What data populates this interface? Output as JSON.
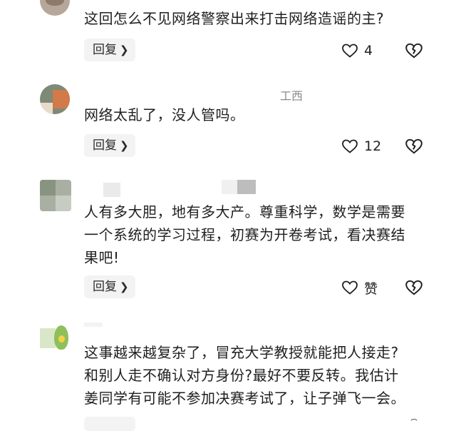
{
  "comments": [
    {
      "text": "这回怎么不见网络警察出来打击网络造谣的主?",
      "reply_label": "回复",
      "like_count": "4"
    },
    {
      "location": "工西",
      "text": "网络太乱了，没人管吗。",
      "reply_label": "回复",
      "like_count": "12"
    },
    {
      "text_lines": [
        "人有多大胆，地有多大产。尊重科学，数学是需要",
        "一个系统的学习过程，初赛为开卷考试，看决赛结",
        "果吧!"
      ],
      "reply_label": "回复",
      "like_count": "赞"
    },
    {
      "text_lines": [
        "这事越来越复杂了，冒充大学教授就能把人接走?",
        "和别人走不确认对方身份?最好不要反转。我估计",
        "姜同学有可能不参加决赛考试了，让子弹飞一会。"
      ]
    }
  ],
  "icons": {
    "like": "heart-outline-icon",
    "dislike": "broken-heart-icon",
    "chevron": "chevron-right-icon"
  }
}
